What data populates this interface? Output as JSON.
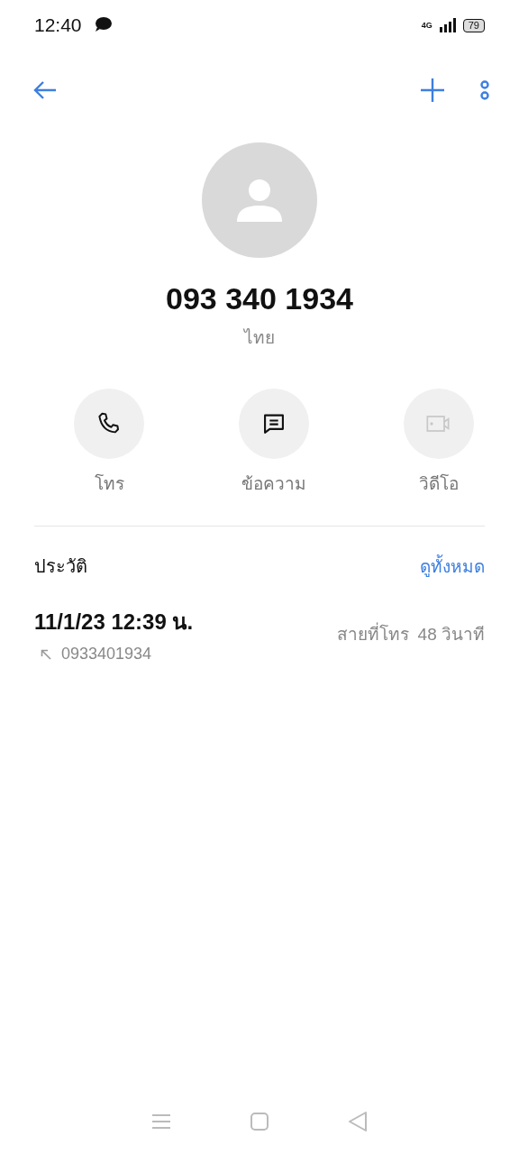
{
  "status_bar": {
    "time": "12:40",
    "network": "4G",
    "battery": "79"
  },
  "contact": {
    "number": "093 340 1934",
    "country": "ไทย"
  },
  "actions": [
    {
      "kind": "call",
      "label": "โทร",
      "disabled": false
    },
    {
      "kind": "message",
      "label": "ข้อความ",
      "disabled": false
    },
    {
      "kind": "video",
      "label": "วิดีโอ",
      "disabled": true
    }
  ],
  "history": {
    "title": "ประวัติ",
    "see_all": "ดูทั้งหมด",
    "entries": [
      {
        "datetime": "11/1/23 12:39 น.",
        "number": "0933401934",
        "kind": "outgoing",
        "type": "สายที่โทร",
        "duration": "48 วินาที"
      }
    ]
  }
}
